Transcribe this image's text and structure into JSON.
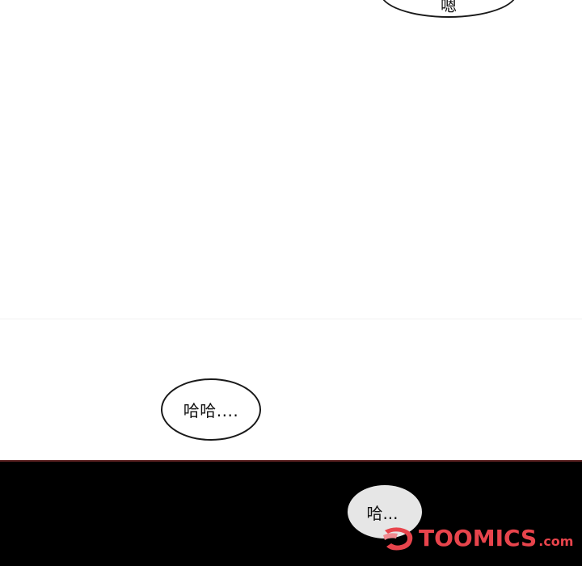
{
  "bubbles": {
    "top": {
      "text": "嗯"
    },
    "middle": {
      "text": "哈哈...."
    },
    "bottom": {
      "text": "哈..."
    }
  },
  "watermark": {
    "brand": "TOOMICS",
    "suffix": ".com",
    "color": "#e8444c"
  },
  "colors": {
    "background": "#ffffff",
    "dark_panel": "#000000",
    "panel_edge": "#5a2020",
    "bubble_border": "#1a1a1a",
    "dark_bubble_fill": "#e6e6e6"
  }
}
